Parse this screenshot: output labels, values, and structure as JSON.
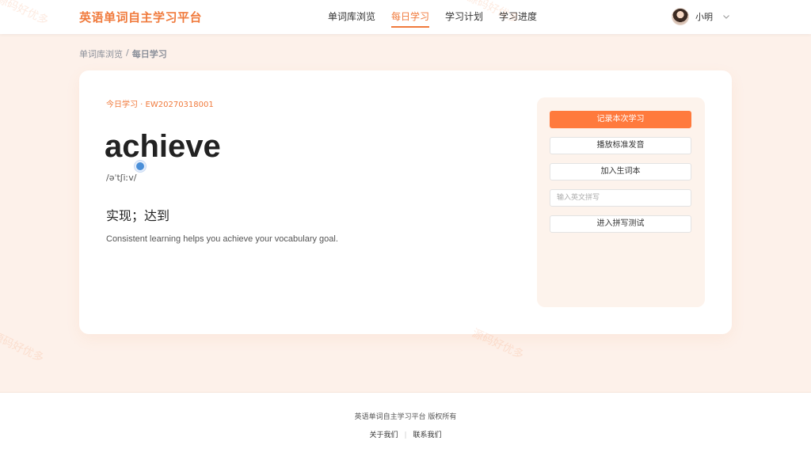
{
  "header": {
    "brand": "英语单词自主学习平台",
    "nav": [
      {
        "label": "单词库浏览",
        "active": false
      },
      {
        "label": "每日学习",
        "active": true
      },
      {
        "label": "学习计划",
        "active": false
      },
      {
        "label": "学习进度",
        "active": false
      }
    ],
    "user_name": "小明"
  },
  "breadcrumb": {
    "parent": "单词库浏览",
    "separator": "/",
    "current": "每日学习"
  },
  "study": {
    "tag": "今日学习 · EW20270318001",
    "word": "achieve",
    "phonetic": "/əˈtʃiːv/",
    "meaning": "实现；达到",
    "example": "Consistent learning helps you achieve your vocabulary goal."
  },
  "actions": {
    "record_label": "记录本次学习",
    "play_label": "播放标准发音",
    "add_label": "加入生词本",
    "spelling_placeholder": "输入英文拼写",
    "spelling_value": "",
    "test_label": "进入拼写测试"
  },
  "footer": {
    "copyright": "英语单词自主学习平台 版权所有",
    "about": "关于我们",
    "contact": "联系我们"
  },
  "watermark": "源码好优多",
  "colors": {
    "accent": "#f07a3c",
    "primary_button": "#ff7a3d",
    "page_bg": "#fdf1ea",
    "side_panel_bg": "#fdf3ec"
  },
  "icons": {
    "user_menu": "chevron-down-icon",
    "avatar": "avatar"
  }
}
